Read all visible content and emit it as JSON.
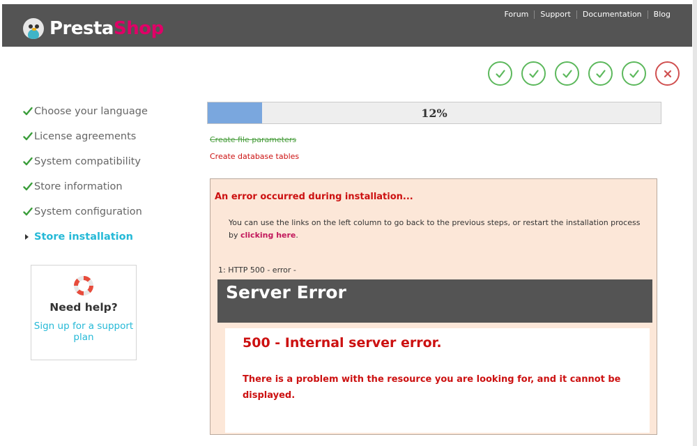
{
  "header": {
    "logo": {
      "presta": "Presta",
      "shop": "Shop"
    },
    "nav": [
      "Forum",
      "Support",
      "Documentation",
      "Blog"
    ]
  },
  "colors": {
    "header_bg": "#545454",
    "brand_pink": "#df0067",
    "accent_cyan": "#25b9d7",
    "success_green": "#5cb85c",
    "error_red": "#cc1111",
    "progress_fill": "#7aa7de",
    "error_panel_bg": "#fce7d8"
  },
  "steps_status": [
    "done",
    "done",
    "done",
    "done",
    "done",
    "failed"
  ],
  "sidebar": {
    "items": [
      {
        "label": "Choose your language",
        "state": "done"
      },
      {
        "label": "License agreements",
        "state": "done"
      },
      {
        "label": "System compatibility",
        "state": "done"
      },
      {
        "label": "Store information",
        "state": "done"
      },
      {
        "label": "System configuration",
        "state": "done"
      },
      {
        "label": "Store installation",
        "state": "active"
      }
    ]
  },
  "help": {
    "icon": "lifebuoy-icon",
    "title": "Need help?",
    "link": "Sign up for a support plan"
  },
  "progress": {
    "percent": 12,
    "label": "12%"
  },
  "tasks": {
    "completed": "Create file parameters",
    "failed": "Create database tables"
  },
  "error": {
    "heading": "An error occurred during installation...",
    "message_before": "You can use the links on the left column to go back to the previous steps, or restart the installation process by ",
    "link": "clicking here",
    "message_after": ".",
    "code_line": "1: HTTP 500 - error -",
    "server_title": "Server Error",
    "server_code": "500 - Internal server error.",
    "server_desc": "There is a problem with the resource you are looking for, and it cannot be displayed."
  }
}
